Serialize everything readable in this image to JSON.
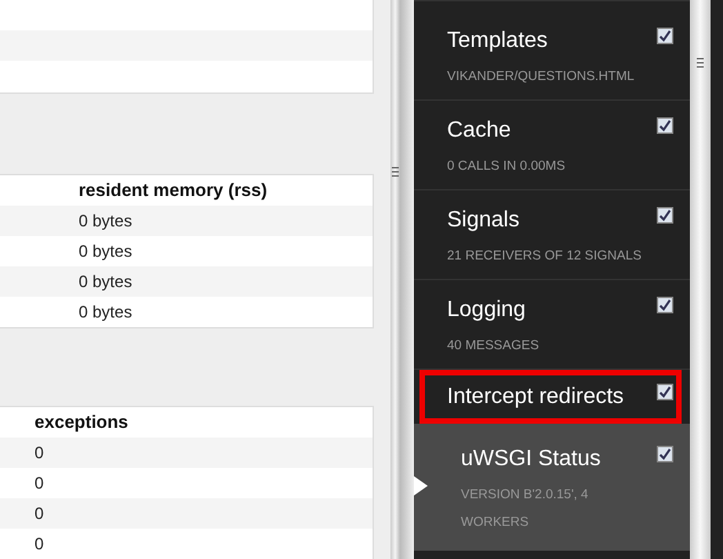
{
  "tables": [
    {
      "columns": [
        "resident memory (rss)"
      ],
      "rows": [
        [
          "0 bytes"
        ],
        [
          "0 bytes"
        ],
        [
          "0 bytes"
        ],
        [
          "0 bytes"
        ]
      ]
    },
    {
      "columns": [
        "exceptions"
      ],
      "rows": [
        [
          "0"
        ],
        [
          "0"
        ],
        [
          "0"
        ],
        [
          "0"
        ]
      ]
    }
  ],
  "toolbar": {
    "panels": [
      {
        "title": "Templates",
        "subtitle": "VIKANDER/QUESTIONS.HTML",
        "checked": true,
        "selected": false,
        "highlighted": false
      },
      {
        "title": "Cache",
        "subtitle": "0 CALLS IN 0.00MS",
        "checked": true,
        "selected": false,
        "highlighted": false
      },
      {
        "title": "Signals",
        "subtitle": "21 RECEIVERS OF 12 SIGNALS",
        "checked": true,
        "selected": false,
        "highlighted": false
      },
      {
        "title": "Logging",
        "subtitle": "40 MESSAGES",
        "checked": true,
        "selected": false,
        "highlighted": false
      },
      {
        "title": "Intercept redirects",
        "checked": true,
        "selected": false,
        "highlighted": true
      },
      {
        "title": "uWSGI Status",
        "subtitle": "VERSION B'2.0.15', 4 WORKERS",
        "checked": true,
        "selected": true,
        "highlighted": false
      }
    ]
  }
}
